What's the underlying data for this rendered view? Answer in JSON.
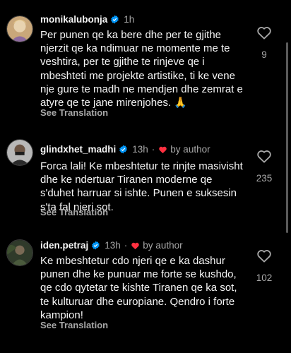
{
  "comments": [
    {
      "username": "monikalubonja",
      "time": "1h",
      "by_author": "",
      "text": "Per punen qe ka bere dhe per te gjithe\nnjerzit qe ka ndimuar ne momente me te\nveshtira, per te gjithe te rinjeve qe i\nmbeshteti me projekte artistike, ti ke vene\nnje gure te madh ne  mendjen dhe zemrat e\natyre qe te jane mirenjohes. 🙏",
      "see_translation": "See Translation",
      "likes": "9"
    },
    {
      "username": "glindxhet_madhi",
      "time": "13h",
      "by_author": "by author",
      "text": "Forca lali! Ke mbeshtetur te rinjte masivisht\ndhe ke ndertuar Tiranen moderne qe\ns'duhet harruar si ishte. Punen e suksesin\ns'ta fal njeri sot.",
      "see_translation": "See Translation",
      "likes": "235"
    },
    {
      "username": "iden.petraj",
      "time": "13h",
      "by_author": "by author",
      "text": "Ke mbeshtetur cdo njeri qe e ka dashur\npunen dhe ke punuar me forte se kushdo,\nqe cdo qytetar te kishte Tiranen qe ka sot,\nte kulturuar dhe europiane. Qendro i forte\nkampion!",
      "see_translation": "See Translation",
      "likes": "102"
    }
  ],
  "colors": {
    "background": "#000000",
    "text": "#f5f5f5",
    "muted": "#a8a8a8",
    "verified": "#0095f6",
    "author_heart": "#ff3040"
  },
  "icons": {
    "verified": "verified-badge-icon",
    "like": "heart-outline-icon",
    "author_like": "heart-filled-icon"
  }
}
